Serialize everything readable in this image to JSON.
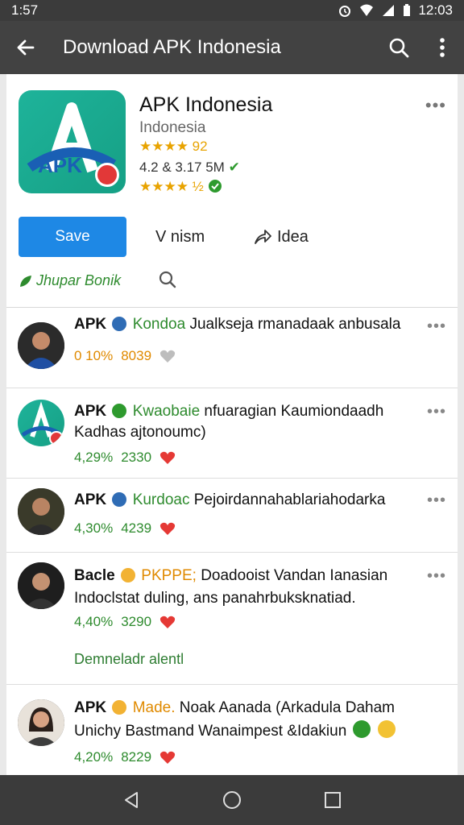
{
  "status_bar": {
    "time": "1:57",
    "clock": "12:03"
  },
  "app_bar": {
    "title": "Download APK Indonesia"
  },
  "app_card": {
    "name": "APK Indonesia",
    "developer": "Indonesia",
    "rating_line_1": "★★★★ 92",
    "meta": "4.2 & 3.17 5M",
    "rating_line_2": "★★★★ ½",
    "logo_text": "APK",
    "primary_button": "Save",
    "secondary_1": "V nism",
    "secondary_2": "Idea",
    "promo": "Jhupar Bonik"
  },
  "feed": [
    {
      "name": "APK",
      "tag": "Kondoa",
      "text": "Jualkseja rmanadaak anbusala",
      "line2": "",
      "stat1": "0 10%",
      "stat2": "8039",
      "heart_color": "#bdbdbd"
    },
    {
      "name": "APK",
      "tag": "Kwaobaie",
      "text": "nfuaragian Kaumiondaadh",
      "line2": "Kadhas ajtonoumc)",
      "stat1": "4,29%",
      "stat2": "2330",
      "heart_color": "#e53935"
    },
    {
      "name": "APK",
      "tag": "Kurdoac",
      "text": "Pejoirdannahablariahodarka",
      "line2": "",
      "stat1": "4,30%",
      "stat2": "4239",
      "heart_color": "#e53935"
    },
    {
      "name": "Bacle",
      "tag": "PKPPE;",
      "text": "Doadooist Vandan Ianasian",
      "line2": "Indoclstat duling, ans panahrbuksknatiad.",
      "stat1": "4,40%",
      "stat2": "3290",
      "heart_color": "#e53935",
      "download": "Demneladr alentl"
    },
    {
      "name": "APK",
      "tag": "Made.",
      "text": "Noak Aanada (Arkadula Daham",
      "line2": "Unichy Bastmand Wanaimpest &Idakiun",
      "stat1": "4,20%",
      "stat2": "8229",
      "heart_color": "#e53935"
    }
  ]
}
